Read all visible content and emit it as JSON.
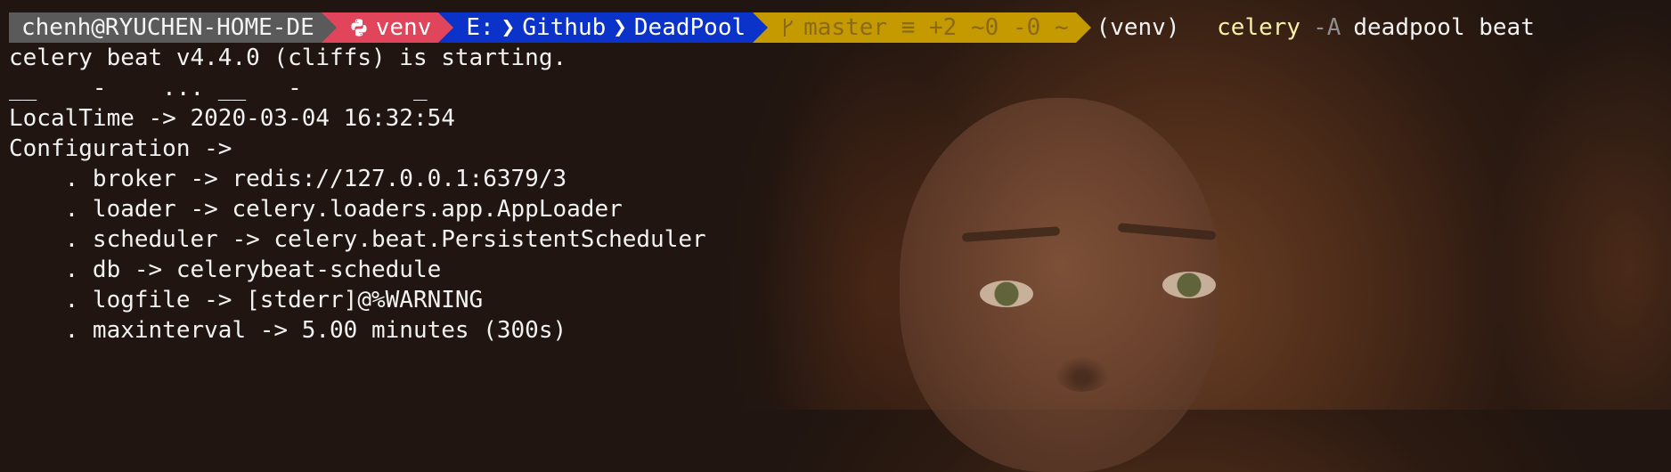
{
  "prompt": {
    "user": "chenh@RYUCHEN-HOME-DE",
    "venv": "venv",
    "path": [
      "E:",
      "Github",
      "DeadPool"
    ],
    "git": "master ≡ +2 ~0 -0 ~",
    "venv_prefix": "(venv)",
    "command": {
      "program": "celery",
      "flag": "-A",
      "args": "deadpool beat"
    }
  },
  "output": [
    "celery beat v4.4.0 (cliffs) is starting.",
    "__    -    ... __   -        _",
    "LocalTime -> 2020-03-04 16:32:54",
    "Configuration ->",
    "    . broker -> redis://127.0.0.1:6379/3",
    "    . loader -> celery.loaders.app.AppLoader",
    "    . scheduler -> celery.beat.PersistentScheduler",
    "    . db -> celerybeat-schedule",
    "    . logfile -> [stderr]@%WARNING",
    "    . maxinterval -> 5.00 minutes (300s)"
  ],
  "colors": {
    "user_bg": "#5a5a5a",
    "venv_bg": "#e0455c",
    "path_bg": "#0b33c9",
    "git_bg": "#c49a00",
    "command_highlight": "#f9f1a5"
  },
  "icons": {
    "venv": "python-icon",
    "git": "branch-icon"
  }
}
